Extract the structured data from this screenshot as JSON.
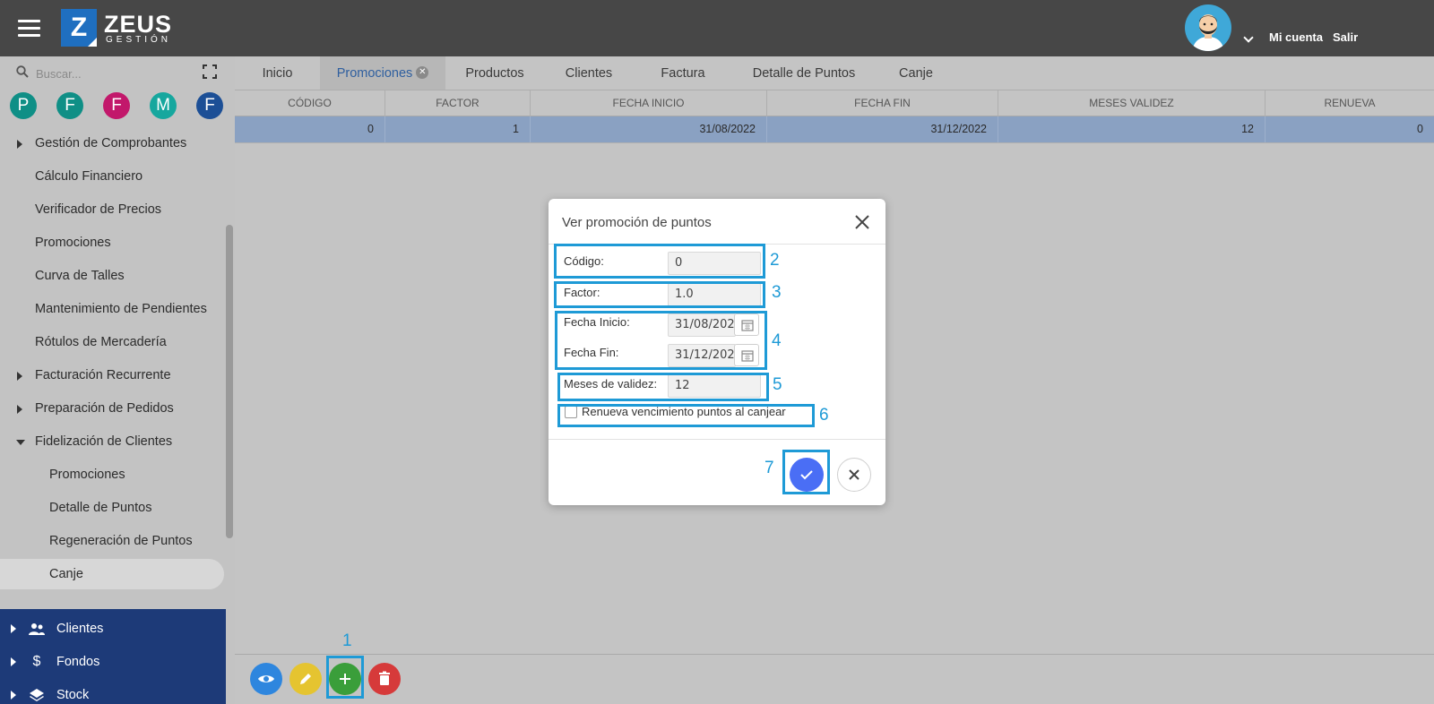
{
  "header": {
    "logo_letter": "Z",
    "brand_name": "ZEUS",
    "brand_sub": "GESTIÓN",
    "account_label": "Mi cuenta",
    "logout_label": "Salir"
  },
  "sidebar": {
    "search_placeholder": "Buscar...",
    "favorites": [
      {
        "letter": "P",
        "color": "#0f8f86"
      },
      {
        "letter": "F",
        "color": "#0f8f86"
      },
      {
        "letter": "F",
        "color": "#c2186b"
      },
      {
        "letter": "M",
        "color": "#16a79e"
      },
      {
        "letter": "F",
        "color": "#1c4f96"
      }
    ],
    "items": [
      {
        "label": "Gestión de Comprobantes"
      },
      {
        "label": "Cálculo Financiero"
      },
      {
        "label": "Verificador de Precios"
      },
      {
        "label": "Promociones"
      },
      {
        "label": "Curva de Talles"
      },
      {
        "label": "Mantenimiento de Pendientes"
      },
      {
        "label": "Rótulos de Mercadería"
      },
      {
        "label": "Facturación Recurrente"
      },
      {
        "label": "Preparación de Pedidos"
      },
      {
        "label": "Fidelización de Clientes"
      },
      {
        "label": "Promociones"
      },
      {
        "label": "Detalle de Puntos"
      },
      {
        "label": "Regeneración de Puntos"
      },
      {
        "label": "Canje"
      }
    ],
    "modules": [
      {
        "label": "Clientes"
      },
      {
        "label": "Fondos"
      },
      {
        "label": "Stock"
      }
    ]
  },
  "tabs": [
    {
      "label": "Inicio"
    },
    {
      "label": "Promociones"
    },
    {
      "label": "Productos"
    },
    {
      "label": "Clientes"
    },
    {
      "label": "Factura"
    },
    {
      "label": "Detalle de Puntos"
    },
    {
      "label": "Canje"
    }
  ],
  "grid": {
    "columns": [
      "CÓDIGO",
      "FACTOR",
      "FECHA INICIO",
      "FECHA FIN",
      "MESES VALIDEZ",
      "RENUEVA"
    ],
    "rows": [
      [
        "0",
        "1",
        "31/08/2022",
        "31/12/2022",
        "12",
        "0"
      ]
    ]
  },
  "dialog": {
    "title": "Ver promoción de puntos",
    "codigo_label": "Código:",
    "codigo_value": "0",
    "factor_label": "Factor:",
    "factor_value": "1.0",
    "fecha_inicio_label": "Fecha Inicio:",
    "fecha_inicio_value": "31/08/202",
    "fecha_fin_label": "Fecha Fin:",
    "fecha_fin_value": "31/12/202",
    "meses_label": "Meses de validez:",
    "meses_value": "12",
    "renueva_label": "Renueva vencimiento puntos al canjear"
  },
  "annotations": [
    "1",
    "2",
    "3",
    "4",
    "5",
    "6",
    "7"
  ],
  "colors": {
    "topbar": "#474747",
    "sidebar_blue": "#1d3a78",
    "selected_row": "#8aa1c2",
    "annotation": "#1e9ad6",
    "ok_button": "#4a6ef5",
    "fab_view": "#2e86de",
    "fab_edit": "#e5c430",
    "fab_add": "#3a9e3a",
    "fab_delete": "#d63a3a"
  }
}
